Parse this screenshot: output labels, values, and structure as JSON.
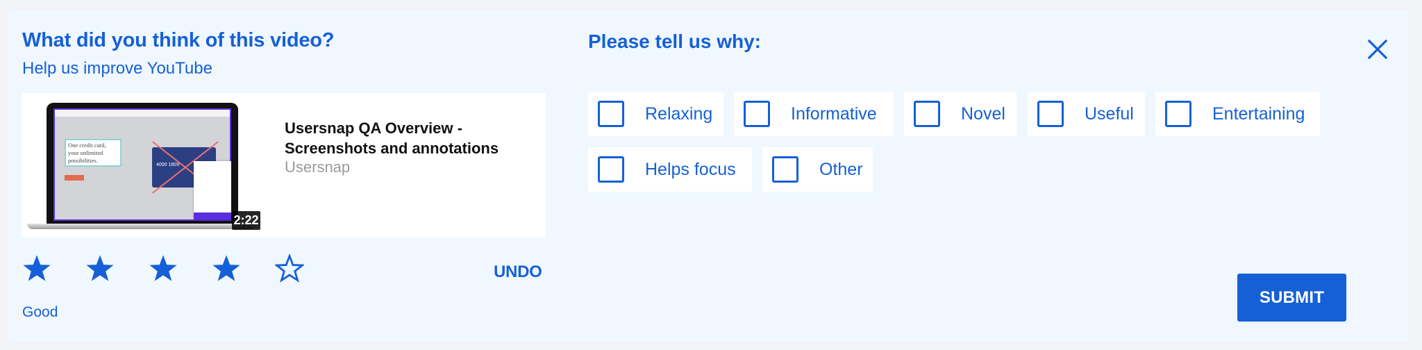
{
  "header": {
    "title": "What did you think of this video?",
    "subtitle": "Help us improve YouTube"
  },
  "video": {
    "title": "Usersnap QA Overview - Screenshots and annotations",
    "channel": "Usersnap",
    "duration": "2:22",
    "thumbnail": {
      "headline": "One credit card, your unlimited possibilities.",
      "card_number": "4000 1809"
    }
  },
  "rating": {
    "value": 4,
    "max": 5,
    "label": "Good",
    "undo_label": "UNDO",
    "icon_filled": "star-filled-icon",
    "icon_empty": "star-outline-icon"
  },
  "reasons": {
    "heading": "Please tell us why:",
    "options": [
      {
        "label": "Relaxing",
        "checked": false
      },
      {
        "label": "Informative",
        "checked": false
      },
      {
        "label": "Novel",
        "checked": false
      },
      {
        "label": "Useful",
        "checked": false
      },
      {
        "label": "Entertaining",
        "checked": false
      },
      {
        "label": "Helps focus",
        "checked": false
      },
      {
        "label": "Other",
        "checked": false
      }
    ]
  },
  "actions": {
    "close_icon": "close-icon",
    "submit_label": "SUBMIT"
  },
  "colors": {
    "accent": "#1560d6",
    "panel_background": "#f0f7ff",
    "card_background": "#ffffff",
    "channel_text": "#9a9a9a"
  }
}
